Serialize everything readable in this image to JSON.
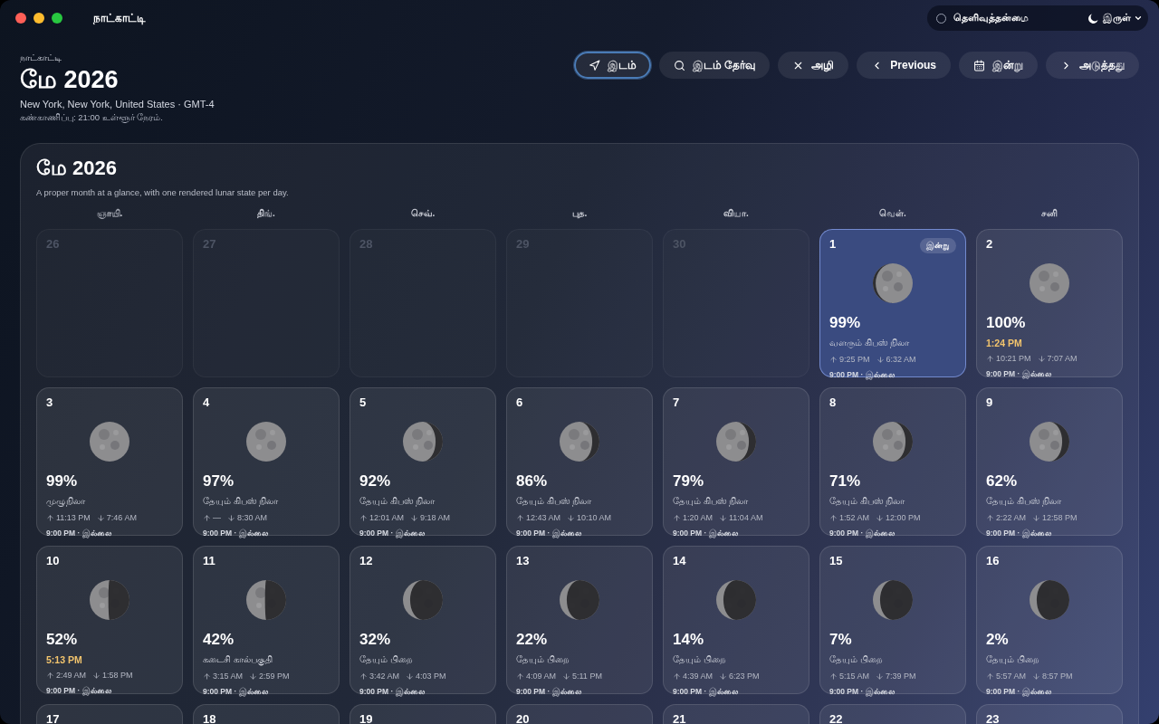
{
  "window": {
    "title": "நாட்காட்டி"
  },
  "top_controls": {
    "clarity": {
      "label": "தெளிவுத்தன்மை",
      "on": false
    },
    "theme": {
      "label": "இருள்"
    }
  },
  "header": {
    "eyebrow": "நாட்காட்டி",
    "title": "மே 2026",
    "location": "New York, New York, United States · GMT-4",
    "tracking": "கண்காணிப்பு: 21:00 உள்ளூர் நேரம்."
  },
  "toolbar": [
    {
      "kind": "location",
      "label": "இடம்",
      "focused": true
    },
    {
      "kind": "search",
      "label": "இடம் தேர்வு",
      "focused": false
    },
    {
      "kind": "clear",
      "label": "அழி",
      "focused": false
    },
    {
      "kind": "previous",
      "label": "Previous",
      "focused": false
    },
    {
      "kind": "today",
      "label": "இன்று",
      "focused": false
    },
    {
      "kind": "next",
      "label": "அடுத்தது",
      "focused": false
    }
  ],
  "calendar": {
    "title": "மே 2026",
    "subtitle": "A proper month at a glance, with one rendered lunar state per day.",
    "weekdays": [
      "ஞாயி.",
      "திங்.",
      "செவ்.",
      "புத.",
      "வியா.",
      "வெள்.",
      "சனி"
    ],
    "days": [
      {
        "kind": "outside",
        "number": "26"
      },
      {
        "kind": "outside",
        "number": "27"
      },
      {
        "kind": "outside",
        "number": "28"
      },
      {
        "kind": "outside",
        "number": "29"
      },
      {
        "kind": "outside",
        "number": "30"
      },
      {
        "kind": "day",
        "number": "1",
        "today": true,
        "badge": "இன்று",
        "moon": {
          "kind": "waxing-gibbous"
        },
        "percent": "99%",
        "note": {
          "kind": "phase",
          "text": "வளரும் கிபஸ் நிலா"
        },
        "rise": "9:25 PM",
        "set": "6:32 AM",
        "footer": "9:00 PM · இல்லை"
      },
      {
        "kind": "day",
        "number": "2",
        "today": false,
        "moon": {
          "kind": "full"
        },
        "percent": "100%",
        "note": {
          "kind": "event",
          "text": "1:24 PM"
        },
        "rise": "10:21 PM",
        "set": "7:07 AM",
        "footer": "9:00 PM · இல்லை"
      },
      {
        "kind": "day",
        "number": "3",
        "today": false,
        "moon": {
          "kind": "full"
        },
        "percent": "99%",
        "note": {
          "kind": "phase",
          "text": "முழுநிலா"
        },
        "rise": "11:13 PM",
        "set": "7:46 AM",
        "footer": "9:00 PM · இல்லை"
      },
      {
        "kind": "day",
        "number": "4",
        "today": false,
        "moon": {
          "kind": "full"
        },
        "percent": "97%",
        "note": {
          "kind": "phase",
          "text": "தேயும் கிபஸ் நிலா"
        },
        "rise": "—",
        "set": "8:30 AM",
        "footer": "9:00 PM · இல்லை"
      },
      {
        "kind": "day",
        "number": "5",
        "today": false,
        "moon": {
          "kind": "waning-gibbous"
        },
        "percent": "92%",
        "note": {
          "kind": "phase",
          "text": "தேயும் கிபஸ் நிலா"
        },
        "rise": "12:01 AM",
        "set": "9:18 AM",
        "footer": "9:00 PM · இல்லை"
      },
      {
        "kind": "day",
        "number": "6",
        "today": false,
        "moon": {
          "kind": "waning-gibbous"
        },
        "percent": "86%",
        "note": {
          "kind": "phase",
          "text": "தேயும் கிபஸ் நிலா"
        },
        "rise": "12:43 AM",
        "set": "10:10 AM",
        "footer": "9:00 PM · இல்லை"
      },
      {
        "kind": "day",
        "number": "7",
        "today": false,
        "moon": {
          "kind": "waning-gibbous"
        },
        "percent": "79%",
        "note": {
          "kind": "phase",
          "text": "தேயும் கிபஸ் நிலா"
        },
        "rise": "1:20 AM",
        "set": "11:04 AM",
        "footer": "9:00 PM · இல்லை"
      },
      {
        "kind": "day",
        "number": "8",
        "today": false,
        "moon": {
          "kind": "waning-gibbous"
        },
        "percent": "71%",
        "note": {
          "kind": "phase",
          "text": "தேயும் கிபஸ் நிலா"
        },
        "rise": "1:52 AM",
        "set": "12:00 PM",
        "footer": "9:00 PM · இல்லை"
      },
      {
        "kind": "day",
        "number": "9",
        "today": false,
        "moon": {
          "kind": "waning-gibbous"
        },
        "percent": "62%",
        "note": {
          "kind": "phase",
          "text": "தேயும் கிபஸ் நிலா"
        },
        "rise": "2:22 AM",
        "set": "12:58 PM",
        "footer": "9:00 PM · இல்லை"
      },
      {
        "kind": "day",
        "number": "10",
        "today": false,
        "moon": {
          "kind": "last-quarter"
        },
        "percent": "52%",
        "note": {
          "kind": "event",
          "text": "5:13 PM"
        },
        "rise": "2:49 AM",
        "set": "1:58 PM",
        "footer": "9:00 PM · இல்லை"
      },
      {
        "kind": "day",
        "number": "11",
        "today": false,
        "moon": {
          "kind": "last-quarter"
        },
        "percent": "42%",
        "note": {
          "kind": "phase",
          "text": "கடைசி கால்பகுதி"
        },
        "rise": "3:15 AM",
        "set": "2:59 PM",
        "footer": "9:00 PM · இல்லை"
      },
      {
        "kind": "day",
        "number": "12",
        "today": false,
        "moon": {
          "kind": "waning-crescent"
        },
        "percent": "32%",
        "note": {
          "kind": "phase",
          "text": "தேயும் பிறை"
        },
        "rise": "3:42 AM",
        "set": "4:03 PM",
        "footer": "9:00 PM · இல்லை"
      },
      {
        "kind": "day",
        "number": "13",
        "today": false,
        "moon": {
          "kind": "waning-crescent"
        },
        "percent": "22%",
        "note": {
          "kind": "phase",
          "text": "தேயும் பிறை"
        },
        "rise": "4:09 AM",
        "set": "5:11 PM",
        "footer": "9:00 PM · இல்லை"
      },
      {
        "kind": "day",
        "number": "14",
        "today": false,
        "moon": {
          "kind": "waning-crescent"
        },
        "percent": "14%",
        "note": {
          "kind": "phase",
          "text": "தேயும் பிறை"
        },
        "rise": "4:39 AM",
        "set": "6:23 PM",
        "footer": "9:00 PM · இல்லை"
      },
      {
        "kind": "day",
        "number": "15",
        "today": false,
        "moon": {
          "kind": "waning-crescent"
        },
        "percent": "7%",
        "note": {
          "kind": "phase",
          "text": "தேயும் பிறை"
        },
        "rise": "5:15 AM",
        "set": "7:39 PM",
        "footer": "9:00 PM · இல்லை"
      },
      {
        "kind": "day",
        "number": "16",
        "today": false,
        "moon": {
          "kind": "waning-crescent"
        },
        "percent": "2%",
        "note": {
          "kind": "phase",
          "text": "தேயும் பிறை"
        },
        "rise": "5:57 AM",
        "set": "8:57 PM",
        "footer": "9:00 PM · இல்லை"
      },
      {
        "kind": "partial",
        "number": "17"
      },
      {
        "kind": "partial",
        "number": "18"
      },
      {
        "kind": "partial",
        "number": "19"
      },
      {
        "kind": "partial",
        "number": "20"
      },
      {
        "kind": "partial",
        "number": "21"
      },
      {
        "kind": "partial",
        "number": "22"
      },
      {
        "kind": "partial",
        "number": "23"
      }
    ]
  }
}
